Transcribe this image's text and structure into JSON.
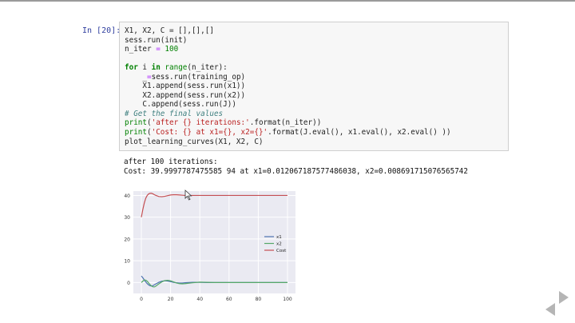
{
  "notebook": {
    "prompt": "In [20]:",
    "code": [
      [
        [
          "X1, X2, C = [],[],[]",
          ""
        ]
      ],
      [
        [
          "sess.run(init)",
          ""
        ]
      ],
      [
        [
          "n_iter ",
          ""
        ],
        [
          "=",
          "op"
        ],
        [
          " ",
          ""
        ],
        [
          "100",
          "num"
        ]
      ],
      [
        [
          "",
          ""
        ]
      ],
      [
        [
          "for",
          "kw"
        ],
        [
          " i ",
          ""
        ],
        [
          "in",
          "kw"
        ],
        [
          " ",
          ""
        ],
        [
          "range",
          "nm"
        ],
        [
          "(n_iter):",
          ""
        ]
      ],
      [
        [
          "    _",
          ""
        ],
        [
          "=",
          "op"
        ],
        [
          "sess.run(training_op)",
          ""
        ]
      ],
      [
        [
          "    X1.append(sess.run(x1))",
          ""
        ]
      ],
      [
        [
          "    X2.append(sess.run(x2))",
          ""
        ]
      ],
      [
        [
          "    C.append(sess.run(J))",
          ""
        ]
      ],
      [
        [
          "# Get the final values",
          "cm"
        ]
      ],
      [
        [
          "print",
          "nm"
        ],
        [
          "(",
          ""
        ],
        [
          "'after {} iterations:'",
          "str"
        ],
        [
          ".format(n_iter))",
          ""
        ]
      ],
      [
        [
          "print",
          "nm"
        ],
        [
          "(",
          ""
        ],
        [
          "'Cost: {} at x1={}, x2={}'",
          "str"
        ],
        [
          ".format(J.eval(), x1.eval(), x2.eval() ))",
          ""
        ]
      ],
      [
        [
          "plot_learning_curves(X1, X2, C)",
          ""
        ]
      ]
    ],
    "output": [
      "after 100 iterations:",
      "Cost: 39.9997787475585 94 at x1=0.012067187577486038, x2=0.008691715076565742"
    ]
  },
  "chart_data": {
    "type": "line",
    "title": "",
    "xlabel": "",
    "ylabel": "",
    "xlim": [
      0,
      100
    ],
    "ylim": [
      -5,
      42
    ],
    "xticks": [
      0,
      20,
      40,
      60,
      80,
      100
    ],
    "yticks": [
      0,
      10,
      20,
      30,
      40
    ],
    "grid": true,
    "legend_position": "right",
    "x": [
      0,
      1,
      2,
      3,
      4,
      5,
      6,
      7,
      8,
      9,
      10,
      12,
      14,
      16,
      18,
      20,
      22,
      24,
      26,
      28,
      30,
      35,
      40,
      45,
      50,
      60,
      70,
      80,
      90,
      100
    ],
    "series": [
      {
        "name": "x1",
        "color": "#4c72b0",
        "values": [
          3.0,
          2.2,
          1.2,
          0.3,
          -0.5,
          -1.1,
          -1.5,
          -1.6,
          -1.4,
          -1.0,
          -0.6,
          0.1,
          0.6,
          0.8,
          0.7,
          0.4,
          0.1,
          -0.1,
          -0.2,
          -0.2,
          -0.1,
          0.1,
          0.1,
          0.0,
          0.0,
          0.0,
          0.0,
          0.0,
          0.0,
          0.0
        ]
      },
      {
        "name": "x2",
        "color": "#55a868",
        "values": [
          0.0,
          0.6,
          1.2,
          1.1,
          0.6,
          -0.2,
          -1.0,
          -1.6,
          -2.0,
          -2.0,
          -1.6,
          -0.6,
          0.3,
          0.9,
          1.0,
          0.8,
          0.3,
          -0.2,
          -0.5,
          -0.6,
          -0.5,
          -0.1,
          0.2,
          0.1,
          0.0,
          0.0,
          0.0,
          0.0,
          0.0,
          0.0
        ]
      },
      {
        "name": "Cost",
        "color": "#c44e52",
        "values": [
          30.0,
          33.5,
          36.5,
          38.7,
          40.0,
          40.7,
          41.0,
          41.0,
          40.7,
          40.3,
          40.0,
          39.5,
          39.4,
          39.6,
          39.9,
          40.2,
          40.3,
          40.3,
          40.2,
          40.1,
          40.0,
          40.0,
          40.0,
          40.0,
          40.0,
          40.0,
          40.0,
          40.0,
          40.0,
          40.0
        ]
      }
    ]
  }
}
